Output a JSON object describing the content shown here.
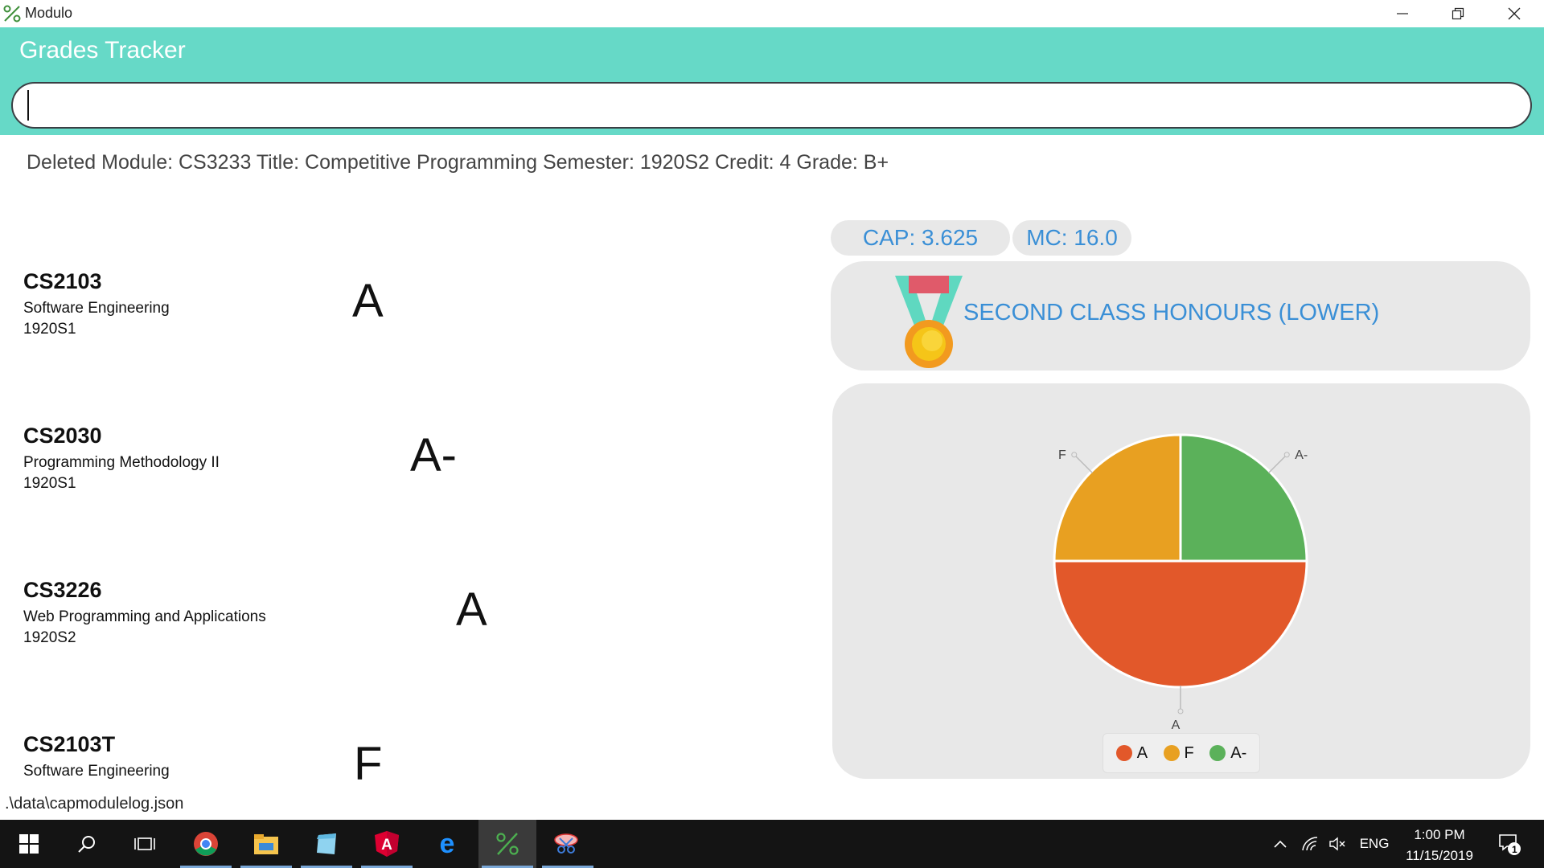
{
  "window": {
    "title": "Modulo"
  },
  "header": {
    "title": "Grades Tracker"
  },
  "command": {
    "value": ""
  },
  "result": {
    "message": "Deleted Module: CS3233 Title: Competitive Programming Semester: 1920S2 Credit: 4 Grade: B+"
  },
  "modules": [
    {
      "code": "CS2103",
      "title": "Software Engineering",
      "semester": "1920S1",
      "grade": "A"
    },
    {
      "code": "CS2030",
      "title": "Programming Methodology II",
      "semester": "1920S1",
      "grade": "A-"
    },
    {
      "code": "CS3226",
      "title": "Web Programming and Applications",
      "semester": "1920S2",
      "grade": "A"
    },
    {
      "code": "CS2103T",
      "title": "Software Engineering",
      "semester": "",
      "grade": "F"
    }
  ],
  "summary": {
    "cap": "CAP: 3.625",
    "mc": "MC: 16.0",
    "honours": "SECOND CLASS HONOURS (LOWER)",
    "medal_icon": "medal-icon"
  },
  "chart_data": {
    "type": "pie",
    "title": "",
    "slices": [
      {
        "label": "A",
        "value": 2,
        "color": "#e2582a"
      },
      {
        "label": "F",
        "value": 1,
        "color": "#e8a021"
      },
      {
        "label": "A-",
        "value": 1,
        "color": "#5bb15a"
      }
    ],
    "legend": [
      "A",
      "F",
      "A-"
    ],
    "legend_position": "bottom"
  },
  "statusbar": {
    "path": ".\\data\\capmodulelog.json"
  },
  "taskbar": {
    "apps": [
      "start-icon",
      "search-icon",
      "task-view-icon",
      "chrome-icon",
      "file-explorer-icon",
      "notepad-icon",
      "angular-icon",
      "edge-icon",
      "modulo-icon",
      "snipping-tool-icon"
    ],
    "language": "ENG",
    "time": "1:00 PM",
    "date": "11/15/2019",
    "notification_count": "1"
  },
  "colors": {
    "accent": "#66d9c7",
    "info_text": "#3a8fd6",
    "card_bg": "#e8e8e8"
  }
}
